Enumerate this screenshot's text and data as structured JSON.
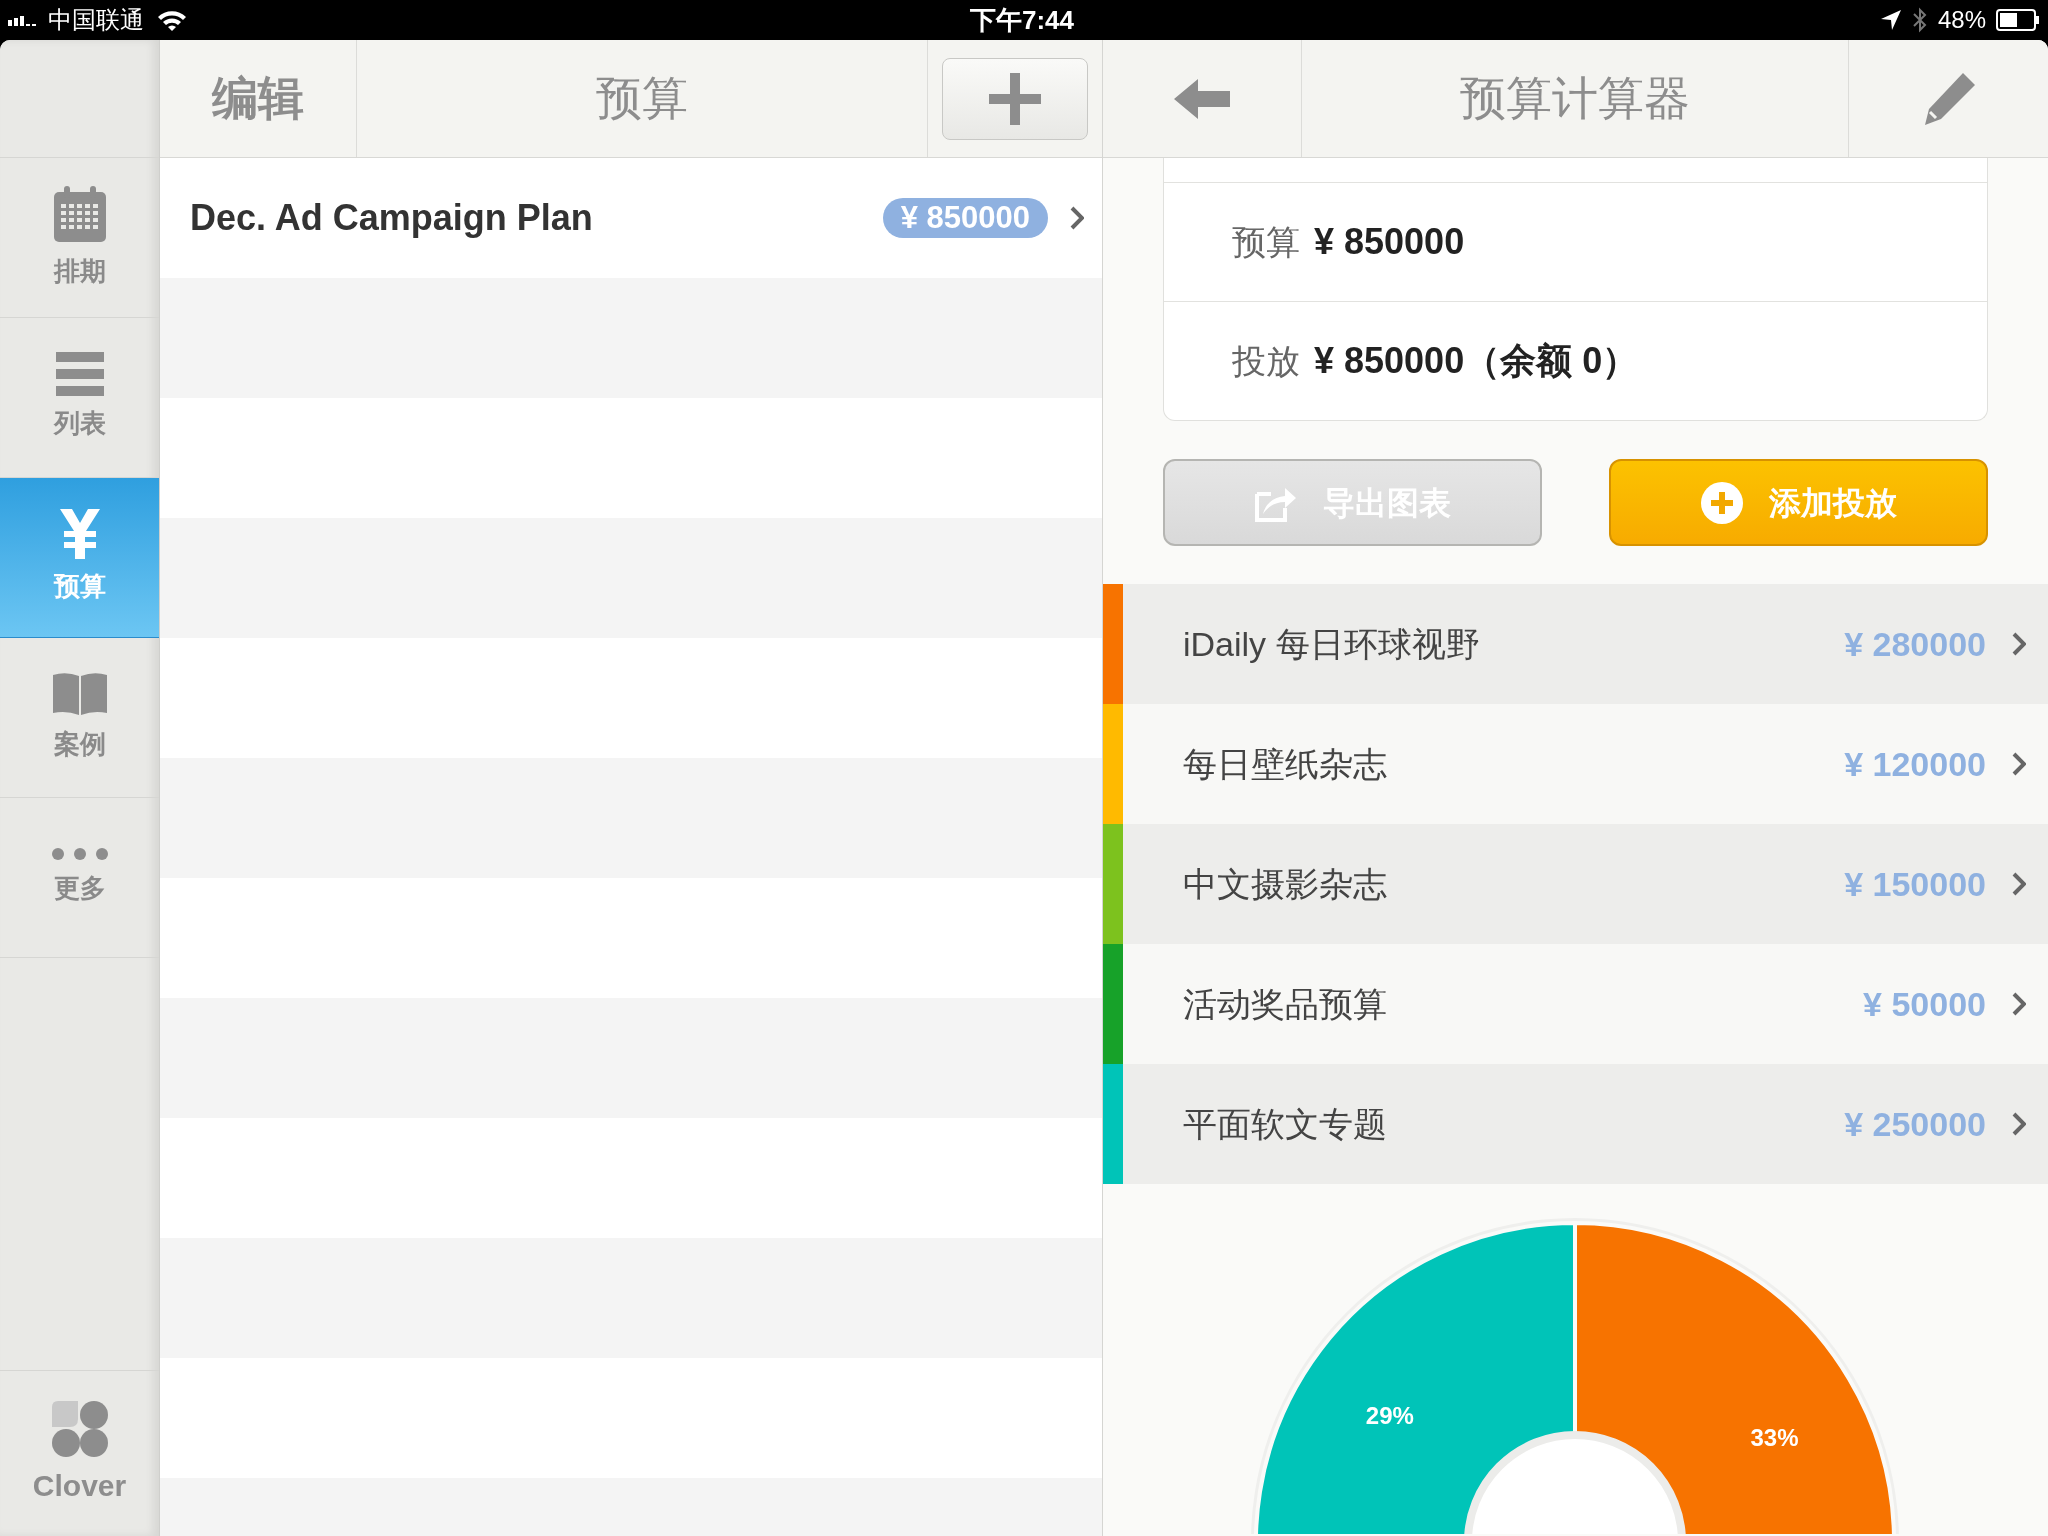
{
  "status_bar": {
    "carrier": "中国联通",
    "time": "下午7:44",
    "battery": "48%"
  },
  "sidebar": {
    "items": [
      {
        "label": "排期",
        "kind": "calendar",
        "selected": false
      },
      {
        "label": "列表",
        "kind": "list",
        "selected": false
      },
      {
        "label": "预算",
        "kind": "yen",
        "selected": true
      },
      {
        "label": "案例",
        "kind": "book",
        "selected": false
      },
      {
        "label": "更多",
        "kind": "more",
        "selected": false
      }
    ],
    "brand": "Clover"
  },
  "list_header": {
    "edit": "编辑",
    "title": "预算"
  },
  "plans": [
    {
      "name": "Dec. Ad Campaign Plan",
      "amount": "¥ 850000"
    }
  ],
  "detail_header": {
    "title": "预算计算器"
  },
  "summary": [
    {
      "label": "预算",
      "value": "¥ 850000"
    },
    {
      "label": "投放",
      "value": "¥ 850000（余额 0）"
    }
  ],
  "buttons": [
    {
      "label": "导出图表",
      "kind": "export",
      "disabled": true
    },
    {
      "label": "添加投放",
      "kind": "add",
      "disabled": false
    }
  ],
  "placements": [
    {
      "name": "iDaily 每日环球视野",
      "amount": "¥ 280000",
      "color": "#f77300",
      "chart_label": "33%"
    },
    {
      "name": "每日壁纸杂志",
      "amount": "¥ 120000",
      "color": "#ffba00"
    },
    {
      "name": "中文摄影杂志",
      "amount": "¥ 150000",
      "color": "#7dc21e"
    },
    {
      "name": "活动奖品预算",
      "amount": "¥ 50000",
      "color": "#17a229"
    },
    {
      "name": "平面软文专题",
      "amount": "¥ 250000",
      "color": "#00c4b8",
      "chart_label": "29%"
    }
  ]
}
